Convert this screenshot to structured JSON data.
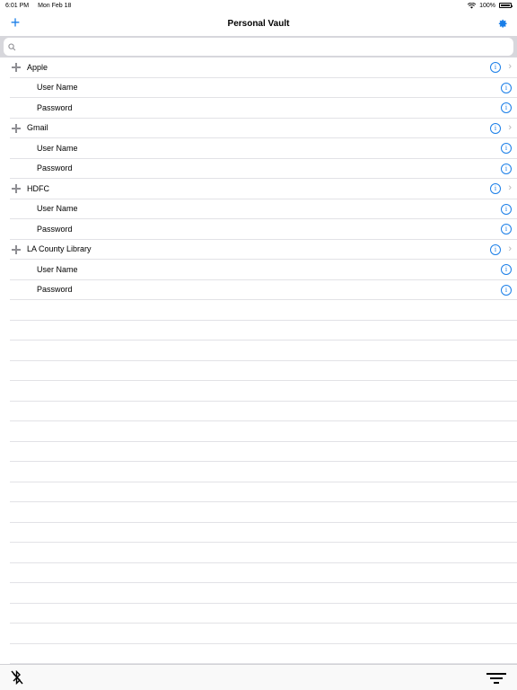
{
  "status": {
    "time": "6:01 PM",
    "date": "Mon Feb 18",
    "battery": "100%"
  },
  "nav": {
    "title": "Personal Vault",
    "add_icon": "plus-icon",
    "settings_icon": "gear-icon"
  },
  "search": {
    "placeholder": "",
    "value": ""
  },
  "groups": [
    {
      "name": "Apple",
      "fields": [
        "User Name",
        "Password"
      ]
    },
    {
      "name": "Gmail",
      "fields": [
        "User Name",
        "Password"
      ]
    },
    {
      "name": "HDFC",
      "fields": [
        "User Name",
        "Password"
      ]
    },
    {
      "name": "LA County Library",
      "fields": [
        "User Name",
        "Password"
      ]
    }
  ],
  "toolbar": {
    "left_icon": "bluetooth-off-icon",
    "right_icon": "filter-icon"
  },
  "colors": {
    "accent": "#1a7ee8",
    "separator": "#e2e2e6",
    "search_bg": "#d7d7dc"
  }
}
